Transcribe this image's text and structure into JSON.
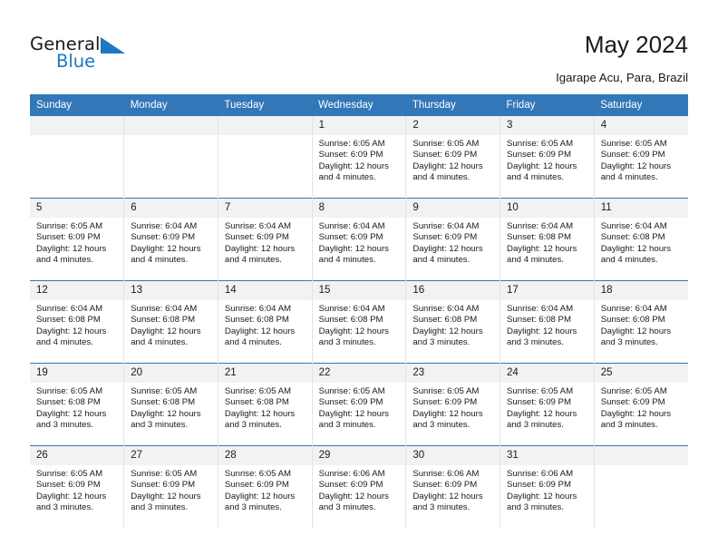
{
  "brand": {
    "name_part1": "General",
    "name_part2": "Blue",
    "mark": "triangle-logo"
  },
  "header": {
    "title": "May 2024",
    "subtitle": "Igarape Acu, Para, Brazil"
  },
  "colors": {
    "header_blue": "#3277b8",
    "brand_blue": "#1f77c4",
    "daynum_band": "#f2f2f2",
    "cell_divider": "#e3e3e3"
  },
  "weekdays": [
    "Sunday",
    "Monday",
    "Tuesday",
    "Wednesday",
    "Thursday",
    "Friday",
    "Saturday"
  ],
  "weeks": [
    [
      {
        "day": "",
        "lines": []
      },
      {
        "day": "",
        "lines": []
      },
      {
        "day": "",
        "lines": []
      },
      {
        "day": "1",
        "lines": [
          "Sunrise: 6:05 AM",
          "Sunset: 6:09 PM",
          "Daylight: 12 hours",
          "and 4 minutes."
        ]
      },
      {
        "day": "2",
        "lines": [
          "Sunrise: 6:05 AM",
          "Sunset: 6:09 PM",
          "Daylight: 12 hours",
          "and 4 minutes."
        ]
      },
      {
        "day": "3",
        "lines": [
          "Sunrise: 6:05 AM",
          "Sunset: 6:09 PM",
          "Daylight: 12 hours",
          "and 4 minutes."
        ]
      },
      {
        "day": "4",
        "lines": [
          "Sunrise: 6:05 AM",
          "Sunset: 6:09 PM",
          "Daylight: 12 hours",
          "and 4 minutes."
        ]
      }
    ],
    [
      {
        "day": "5",
        "lines": [
          "Sunrise: 6:05 AM",
          "Sunset: 6:09 PM",
          "Daylight: 12 hours",
          "and 4 minutes."
        ]
      },
      {
        "day": "6",
        "lines": [
          "Sunrise: 6:04 AM",
          "Sunset: 6:09 PM",
          "Daylight: 12 hours",
          "and 4 minutes."
        ]
      },
      {
        "day": "7",
        "lines": [
          "Sunrise: 6:04 AM",
          "Sunset: 6:09 PM",
          "Daylight: 12 hours",
          "and 4 minutes."
        ]
      },
      {
        "day": "8",
        "lines": [
          "Sunrise: 6:04 AM",
          "Sunset: 6:09 PM",
          "Daylight: 12 hours",
          "and 4 minutes."
        ]
      },
      {
        "day": "9",
        "lines": [
          "Sunrise: 6:04 AM",
          "Sunset: 6:09 PM",
          "Daylight: 12 hours",
          "and 4 minutes."
        ]
      },
      {
        "day": "10",
        "lines": [
          "Sunrise: 6:04 AM",
          "Sunset: 6:08 PM",
          "Daylight: 12 hours",
          "and 4 minutes."
        ]
      },
      {
        "day": "11",
        "lines": [
          "Sunrise: 6:04 AM",
          "Sunset: 6:08 PM",
          "Daylight: 12 hours",
          "and 4 minutes."
        ]
      }
    ],
    [
      {
        "day": "12",
        "lines": [
          "Sunrise: 6:04 AM",
          "Sunset: 6:08 PM",
          "Daylight: 12 hours",
          "and 4 minutes."
        ]
      },
      {
        "day": "13",
        "lines": [
          "Sunrise: 6:04 AM",
          "Sunset: 6:08 PM",
          "Daylight: 12 hours",
          "and 4 minutes."
        ]
      },
      {
        "day": "14",
        "lines": [
          "Sunrise: 6:04 AM",
          "Sunset: 6:08 PM",
          "Daylight: 12 hours",
          "and 4 minutes."
        ]
      },
      {
        "day": "15",
        "lines": [
          "Sunrise: 6:04 AM",
          "Sunset: 6:08 PM",
          "Daylight: 12 hours",
          "and 3 minutes."
        ]
      },
      {
        "day": "16",
        "lines": [
          "Sunrise: 6:04 AM",
          "Sunset: 6:08 PM",
          "Daylight: 12 hours",
          "and 3 minutes."
        ]
      },
      {
        "day": "17",
        "lines": [
          "Sunrise: 6:04 AM",
          "Sunset: 6:08 PM",
          "Daylight: 12 hours",
          "and 3 minutes."
        ]
      },
      {
        "day": "18",
        "lines": [
          "Sunrise: 6:04 AM",
          "Sunset: 6:08 PM",
          "Daylight: 12 hours",
          "and 3 minutes."
        ]
      }
    ],
    [
      {
        "day": "19",
        "lines": [
          "Sunrise: 6:05 AM",
          "Sunset: 6:08 PM",
          "Daylight: 12 hours",
          "and 3 minutes."
        ]
      },
      {
        "day": "20",
        "lines": [
          "Sunrise: 6:05 AM",
          "Sunset: 6:08 PM",
          "Daylight: 12 hours",
          "and 3 minutes."
        ]
      },
      {
        "day": "21",
        "lines": [
          "Sunrise: 6:05 AM",
          "Sunset: 6:08 PM",
          "Daylight: 12 hours",
          "and 3 minutes."
        ]
      },
      {
        "day": "22",
        "lines": [
          "Sunrise: 6:05 AM",
          "Sunset: 6:09 PM",
          "Daylight: 12 hours",
          "and 3 minutes."
        ]
      },
      {
        "day": "23",
        "lines": [
          "Sunrise: 6:05 AM",
          "Sunset: 6:09 PM",
          "Daylight: 12 hours",
          "and 3 minutes."
        ]
      },
      {
        "day": "24",
        "lines": [
          "Sunrise: 6:05 AM",
          "Sunset: 6:09 PM",
          "Daylight: 12 hours",
          "and 3 minutes."
        ]
      },
      {
        "day": "25",
        "lines": [
          "Sunrise: 6:05 AM",
          "Sunset: 6:09 PM",
          "Daylight: 12 hours",
          "and 3 minutes."
        ]
      }
    ],
    [
      {
        "day": "26",
        "lines": [
          "Sunrise: 6:05 AM",
          "Sunset: 6:09 PM",
          "Daylight: 12 hours",
          "and 3 minutes."
        ]
      },
      {
        "day": "27",
        "lines": [
          "Sunrise: 6:05 AM",
          "Sunset: 6:09 PM",
          "Daylight: 12 hours",
          "and 3 minutes."
        ]
      },
      {
        "day": "28",
        "lines": [
          "Sunrise: 6:05 AM",
          "Sunset: 6:09 PM",
          "Daylight: 12 hours",
          "and 3 minutes."
        ]
      },
      {
        "day": "29",
        "lines": [
          "Sunrise: 6:06 AM",
          "Sunset: 6:09 PM",
          "Daylight: 12 hours",
          "and 3 minutes."
        ]
      },
      {
        "day": "30",
        "lines": [
          "Sunrise: 6:06 AM",
          "Sunset: 6:09 PM",
          "Daylight: 12 hours",
          "and 3 minutes."
        ]
      },
      {
        "day": "31",
        "lines": [
          "Sunrise: 6:06 AM",
          "Sunset: 6:09 PM",
          "Daylight: 12 hours",
          "and 3 minutes."
        ]
      },
      {
        "day": "",
        "lines": []
      }
    ]
  ]
}
